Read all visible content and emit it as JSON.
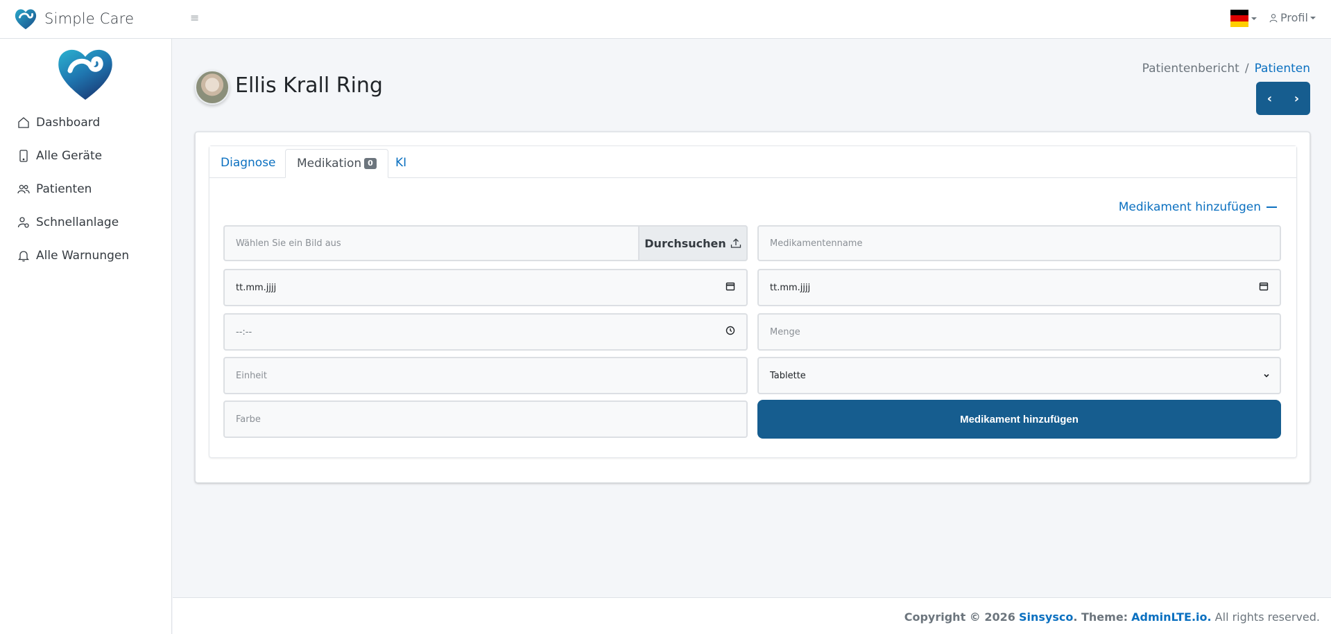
{
  "brand": {
    "name": "Simple Care",
    "accent": "#165d8f"
  },
  "header": {
    "menu_icon": "hamburger-icon",
    "language_flag": "germany-flag",
    "profile_label": "Profil"
  },
  "sidebar": {
    "items": [
      {
        "label": "Dashboard",
        "icon": "home-icon"
      },
      {
        "label": "Alle Geräte",
        "icon": "tablet-icon"
      },
      {
        "label": "Patienten",
        "icon": "users-icon"
      },
      {
        "label": "Schnellanlage",
        "icon": "user-gear-icon"
      },
      {
        "label": "Alle Warnungen",
        "icon": "bell-icon"
      }
    ]
  },
  "patient": {
    "name": "Ellis Krall Ring"
  },
  "breadcrumb": {
    "parent": "Patientenbericht",
    "separator": "/",
    "current": "Patienten"
  },
  "pager": {
    "prev": "‹",
    "next": "›"
  },
  "tabs": {
    "diagnose": "Diagnose",
    "medikation": "Medikation",
    "medikation_count": "0",
    "ki": "KI"
  },
  "form": {
    "toggle_label": "Medikament hinzufügen",
    "image_placeholder": "Wählen Sie ein Bild aus",
    "browse_label": "Durchsuchen",
    "name_placeholder": "Medikamentenname",
    "start_date_placeholder": "tt.mm.jjjj",
    "end_date_placeholder": "tt.mm.jjjj",
    "time_placeholder": "--:--",
    "amount_placeholder": "Menge",
    "unit_placeholder": "Einheit",
    "form_type_value": "Tablette",
    "color_placeholder": "Farbe",
    "submit_label": "Medikament hinzufügen"
  },
  "footer": {
    "copyright": "Copyright © 2026",
    "company": "Sinsysco",
    "theme_prefix": ". Theme:",
    "theme_link": "AdminLTE.io.",
    "rights": "All rights reserved."
  }
}
